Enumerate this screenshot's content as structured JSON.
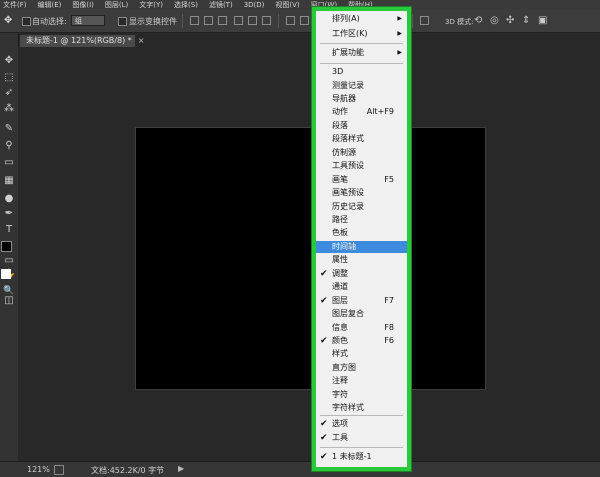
{
  "menubar": {
    "items": [
      "文件(F)",
      "编辑(E)",
      "图像(I)",
      "图层(L)",
      "文字(Y)",
      "选择(S)",
      "滤镜(T)",
      "3D(D)",
      "视图(V)",
      "窗口(W)",
      "帮助(H)"
    ]
  },
  "options": {
    "auto_select_label": "自动选择:",
    "auto_select_value": "组",
    "show_transform_label": "显示变换控件",
    "mode_3d": "3D 模式:"
  },
  "document": {
    "tab_title": "未标题-1 @ 121%(RGB/8) *",
    "close": "×"
  },
  "status": {
    "zoom": "121%",
    "doc_info": "文档:452.2K/0 字节",
    "arrow": "▶"
  },
  "window_menu": {
    "top": [
      {
        "label": "排列(A)",
        "submenu": true
      },
      {
        "label": "工作区(K)",
        "submenu": true
      }
    ],
    "ext": [
      {
        "label": "扩展功能",
        "submenu": true
      }
    ],
    "panels": [
      {
        "label": "3D",
        "shortcut": "",
        "checked": false
      },
      {
        "label": "测量记录",
        "shortcut": "",
        "checked": false
      },
      {
        "label": "导航器",
        "shortcut": "",
        "checked": false
      },
      {
        "label": "动作",
        "shortcut": "Alt+F9",
        "checked": false
      },
      {
        "label": "段落",
        "shortcut": "",
        "checked": false
      },
      {
        "label": "段落样式",
        "shortcut": "",
        "checked": false
      },
      {
        "label": "仿制源",
        "shortcut": "",
        "checked": false
      },
      {
        "label": "工具预设",
        "shortcut": "",
        "checked": false
      },
      {
        "label": "画笔",
        "shortcut": "F5",
        "checked": false
      },
      {
        "label": "画笔预设",
        "shortcut": "",
        "checked": false
      },
      {
        "label": "历史记录",
        "shortcut": "",
        "checked": false
      },
      {
        "label": "路径",
        "shortcut": "",
        "checked": false
      },
      {
        "label": "色板",
        "shortcut": "",
        "checked": false
      },
      {
        "label": "时间轴",
        "shortcut": "",
        "checked": false,
        "highlighted": true
      },
      {
        "label": "属性",
        "shortcut": "",
        "checked": false
      },
      {
        "label": "调整",
        "shortcut": "",
        "checked": true
      },
      {
        "label": "通道",
        "shortcut": "",
        "checked": false
      },
      {
        "label": "图层",
        "shortcut": "F7",
        "checked": true
      },
      {
        "label": "图层复合",
        "shortcut": "",
        "checked": false
      },
      {
        "label": "信息",
        "shortcut": "F8",
        "checked": false
      },
      {
        "label": "颜色",
        "shortcut": "F6",
        "checked": true
      },
      {
        "label": "样式",
        "shortcut": "",
        "checked": false
      },
      {
        "label": "直方图",
        "shortcut": "",
        "checked": false
      },
      {
        "label": "注释",
        "shortcut": "",
        "checked": false
      },
      {
        "label": "字符",
        "shortcut": "",
        "checked": false
      },
      {
        "label": "字符样式",
        "shortcut": "",
        "checked": false
      }
    ],
    "bottom": [
      {
        "label": "选项",
        "checked": true
      },
      {
        "label": "工具",
        "checked": true
      }
    ],
    "docs": [
      {
        "label": "1 未标题-1",
        "checked": true
      }
    ]
  },
  "colors": {
    "menu_outline": "#28c93a",
    "highlight": "#3d8bde"
  }
}
